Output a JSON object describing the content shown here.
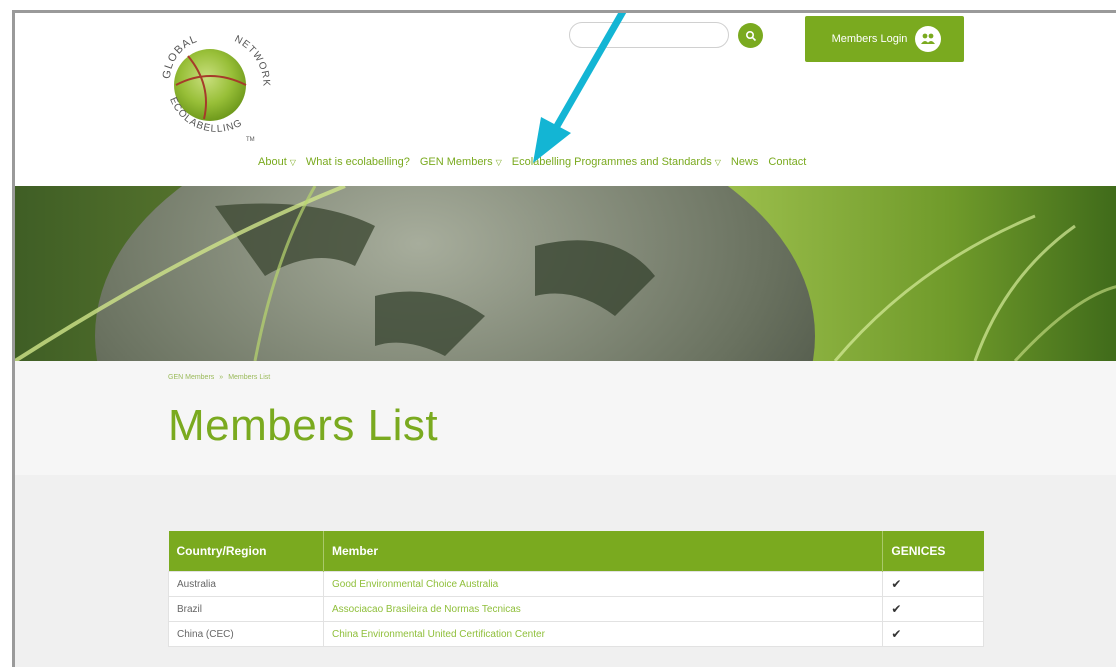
{
  "brand": {
    "logo_text_top": "GLOBAL",
    "logo_text_right": "NETWORK",
    "logo_text_left": "ECOLABELLING",
    "logo_tm": "TM"
  },
  "search": {
    "value": "",
    "placeholder": ""
  },
  "login": {
    "label": "Members Login",
    "icon": "members-icon"
  },
  "nav": {
    "items": [
      {
        "label": "About",
        "dropdown": true
      },
      {
        "label": "What is ecolabelling?",
        "dropdown": false
      },
      {
        "label": "GEN Members",
        "dropdown": true
      },
      {
        "label": "Ecolabelling Programmes and Standards",
        "dropdown": true
      },
      {
        "label": "News",
        "dropdown": false
      },
      {
        "label": "Contact",
        "dropdown": false
      }
    ]
  },
  "breadcrumb": {
    "parent": "GEN Members",
    "separator": "»",
    "current": "Members List"
  },
  "page": {
    "title": "Members List"
  },
  "table": {
    "headers": [
      "Country/Region",
      "Member",
      "GENICES"
    ],
    "rows": [
      {
        "country": "Australia",
        "member": "Good Environmental Choice Australia",
        "genices": "✔"
      },
      {
        "country": "Brazil",
        "member": "Associacao Brasileira de Normas Tecnicas",
        "genices": "✔"
      },
      {
        "country": "China (CEC)",
        "member": "China Environmental United Certification Center",
        "genices": "✔"
      }
    ]
  },
  "colors": {
    "accent": "#7aaa1f",
    "annotation_arrow": "#13b5d4"
  }
}
